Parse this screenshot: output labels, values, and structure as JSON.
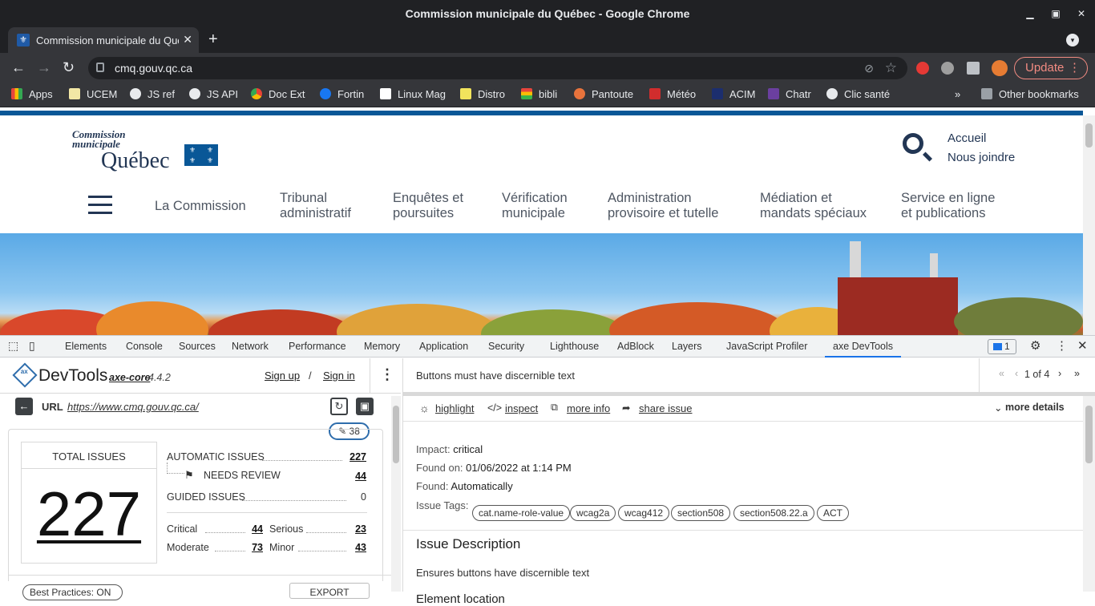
{
  "window": {
    "title": "Commission municipale du Québec - Google Chrome",
    "tab_title": "Commission municipale du Québec"
  },
  "toolbar": {
    "url": "cmq.gouv.qc.ca",
    "update_label": "Update"
  },
  "bookmarks": {
    "items": [
      {
        "label": "Apps",
        "color": "#e8453c"
      },
      {
        "label": "UCEM",
        "color": "#f2e7a5"
      },
      {
        "label": "JS ref",
        "color": "#e8eaed"
      },
      {
        "label": "JS API",
        "color": "#e8eaed"
      },
      {
        "label": "Doc Ext",
        "color": "#4285f4"
      },
      {
        "label": "Fortin",
        "color": "#1877f2"
      },
      {
        "label": "Linux Mag",
        "color": "#ffffff"
      },
      {
        "label": "Distro",
        "color": "#f2e45c"
      },
      {
        "label": "bibli",
        "color": "#3bb34a"
      },
      {
        "label": "Pantoute",
        "color": "#e8733c"
      },
      {
        "label": "Météo",
        "color": "#d12d2d"
      },
      {
        "label": "ACIM",
        "color": "#1c2e6e"
      },
      {
        "label": "Chatr",
        "color": "#6b3fa0"
      },
      {
        "label": "Clic santé",
        "color": "#e8eaed"
      }
    ],
    "other": "Other bookmarks"
  },
  "site": {
    "logo_line1": "Commission",
    "logo_line2": "municipale",
    "logo_line3": "Québec",
    "links": [
      "Accueil",
      "Nous joindre"
    ],
    "nav": [
      {
        "line1": "La Commission",
        "line2": ""
      },
      {
        "line1": "Tribunal",
        "line2": "administratif"
      },
      {
        "line1": "Enquêtes et",
        "line2": "poursuites"
      },
      {
        "line1": "Vérification",
        "line2": "municipale"
      },
      {
        "line1": "Administration",
        "line2": "provisoire et tutelle"
      },
      {
        "line1": "Médiation et",
        "line2": "mandats spéciaux"
      },
      {
        "line1": "Service en ligne",
        "line2": "et publications"
      }
    ]
  },
  "devtools": {
    "tabs": [
      "Elements",
      "Console",
      "Sources",
      "Network",
      "Performance",
      "Memory",
      "Application",
      "Security",
      "Lighthouse",
      "AdBlock",
      "Layers",
      "JavaScript Profiler",
      "axe DevTools"
    ],
    "active_tab": "axe DevTools",
    "issues_count": "1"
  },
  "axe": {
    "brand": "DevTools",
    "core": "axe-core",
    "version": "4.4.2",
    "sign_up": "Sign up",
    "separator": "/",
    "sign_in": "Sign in",
    "url_label": "URL",
    "url": "https://www.cmq.gouv.qc.ca/",
    "pill_count": "38",
    "total_label": "TOTAL ISSUES",
    "total": "227",
    "automatic_label": "AUTOMATIC ISSUES",
    "automatic": "227",
    "needs_review_label": "NEEDS REVIEW",
    "needs_review": "44",
    "guided_label": "GUIDED ISSUES",
    "guided": "0",
    "critical_label": "Critical",
    "critical": "44",
    "serious_label": "Serious",
    "serious": "23",
    "moderate_label": "Moderate",
    "moderate": "73",
    "minor_label": "Minor",
    "minor": "43",
    "best_practices": "Best Practices: ON",
    "export": "EXPORT"
  },
  "issue": {
    "title": "Buttons must have discernible text",
    "pager": "1 of 4",
    "actions": [
      "highlight",
      "inspect",
      "more info",
      "share issue"
    ],
    "more_details": "more details",
    "impact_label": "Impact:",
    "impact": "critical",
    "found_on_label": "Found on:",
    "found_on": "01/06/2022 at 1:14 PM",
    "found_label": "Found:",
    "found": "Automatically",
    "tags_label": "Issue Tags:",
    "tags": [
      "cat.name-role-value",
      "wcag2a",
      "wcag412",
      "section508",
      "section508.22.a",
      "ACT"
    ],
    "description_heading": "Issue Description",
    "description": "Ensures buttons have discernible text",
    "element_location": "Element location"
  }
}
